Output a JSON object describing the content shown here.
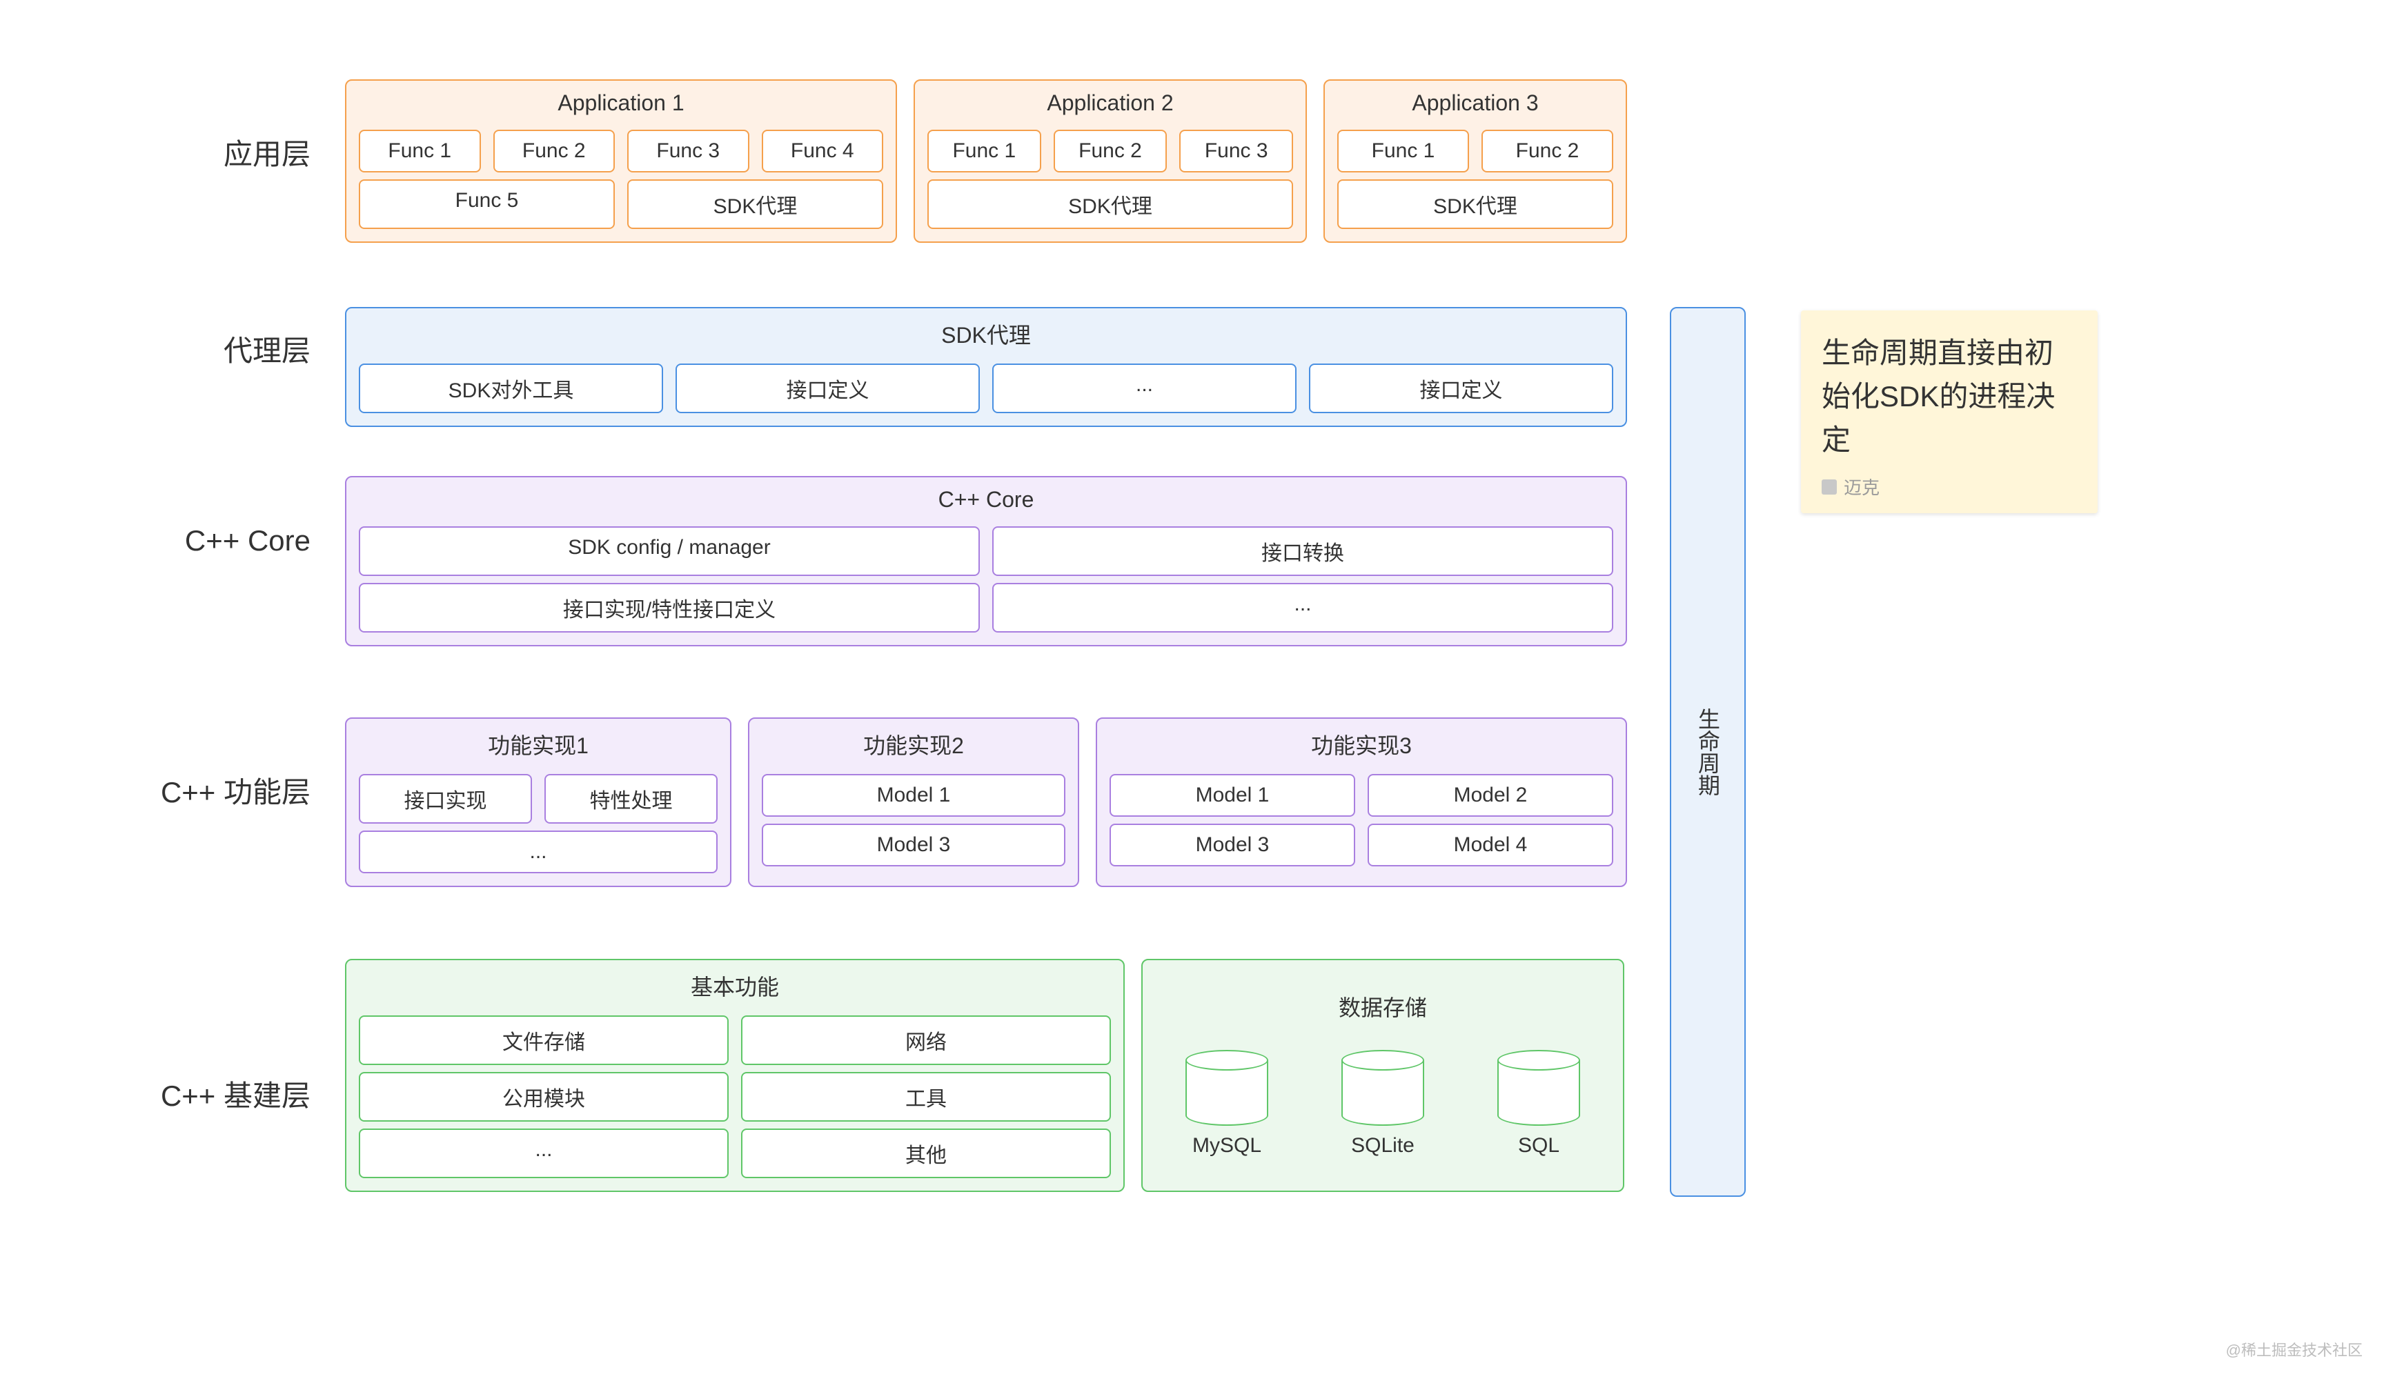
{
  "labels": {
    "app": "应用层",
    "proxy": "代理层",
    "core": "C++ Core",
    "func": "C++ 功能层",
    "base": "C++ 基建层"
  },
  "app": {
    "a1": {
      "title": "Application 1",
      "f1": "Func 1",
      "f2": "Func 2",
      "f3": "Func 3",
      "f4": "Func 4",
      "f5": "Func 5",
      "sdk": "SDK代理"
    },
    "a2": {
      "title": "Application 2",
      "f1": "Func 1",
      "f2": "Func 2",
      "f3": "Func 3",
      "sdk": "SDK代理"
    },
    "a3": {
      "title": "Application 3",
      "f1": "Func 1",
      "f2": "Func 2",
      "sdk": "SDK代理"
    }
  },
  "proxy": {
    "title": "SDK代理",
    "c1": "SDK对外工具",
    "c2": "接口定义",
    "c3": "...",
    "c4": "接口定义"
  },
  "core": {
    "title": "C++ Core",
    "c1": "SDK config / manager",
    "c2": "接口转换",
    "c3": "接口实现/特性接口定义",
    "c4": "..."
  },
  "func": {
    "b1": {
      "title": "功能实现1",
      "c1": "接口实现",
      "c2": "特性处理",
      "c3": "..."
    },
    "b2": {
      "title": "功能实现2",
      "c1": "Model 1",
      "c2": "Model 3"
    },
    "b3": {
      "title": "功能实现3",
      "c1": "Model 1",
      "c2": "Model 2",
      "c3": "Model 3",
      "c4": "Model 4"
    }
  },
  "base": {
    "basic": {
      "title": "基本功能",
      "c1": "文件存储",
      "c2": "网络",
      "c3": "公用模块",
      "c4": "工具",
      "c5": "...",
      "c6": "其他"
    },
    "data": {
      "title": "数据存储",
      "d1": "MySQL",
      "d2": "SQLite",
      "d3": "SQL"
    }
  },
  "lifecycle": "生命周期",
  "note": {
    "text": "生命周期直接由初始化SDK的进程决定",
    "author": "迈克"
  },
  "watermark": "@稀土掘金技术社区"
}
